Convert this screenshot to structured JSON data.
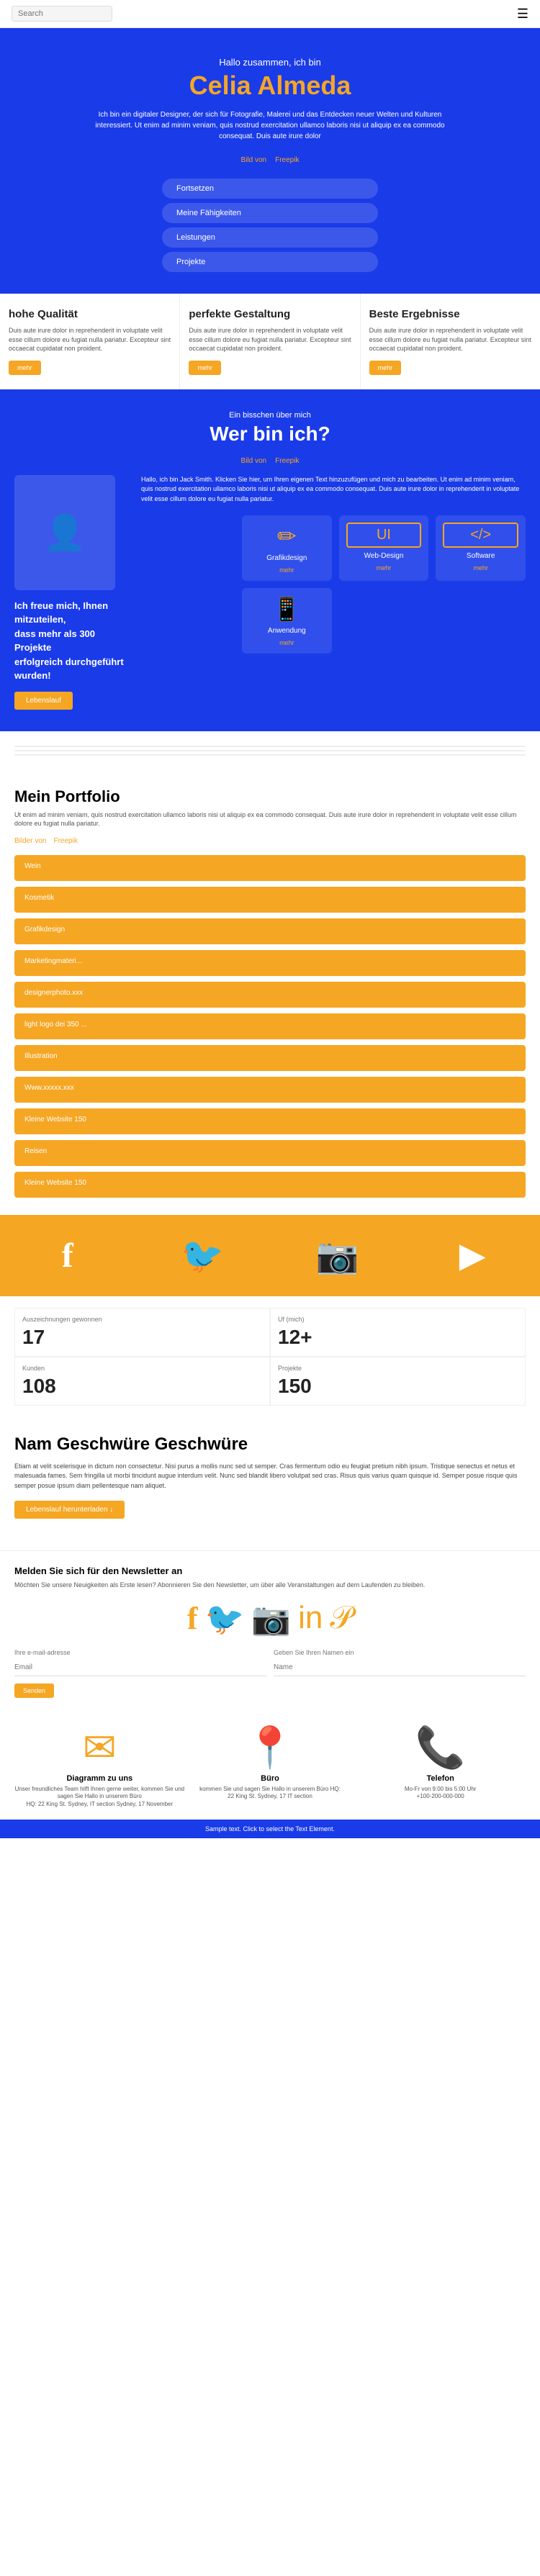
{
  "header": {
    "search_placeholder": "Search",
    "hamburger_icon": "☰"
  },
  "hero": {
    "greeting": "Hallo zusammen, ich bin",
    "name": "Celia Almeda",
    "description": "Ich bin ein digitaler Designer, der sich für Fotografie, Malerei und das Entdecken neuer Welten und Kulturen interessiert. Ut enim ad minim veniam, quis nostrud exercitation ullamco laboris nisi ut aliquip ex ea commodo consequat. Duis aute irure dolor",
    "toggle_bild": "Bild von",
    "toggle_freepik": "Freepik",
    "menu_items": [
      "Fortsetzen",
      "Meine Fähigkeiten",
      "Leistungen",
      "Projekte"
    ]
  },
  "features": [
    {
      "title": "hohe Qualität",
      "description": "Duis aute irure dolor in reprehenderit in voluptate velit esse cillum dolore eu fugiat nulla pariatur. Excepteur sint occaecat cupidatat non proident.",
      "button_label": "mehr"
    },
    {
      "title": "perfekte Gestaltung",
      "description": "Duis aute irure dolor in reprehenderit in voluptate velit esse cillum dolore eu fugiat nulla pariatur. Excepteur sint occaecat cupidatat non proident.",
      "button_label": "mehr"
    },
    {
      "title": "Beste Ergebnisse",
      "description": "Duis aute irure dolor in reprehenderit in voluptate velit esse cillum dolore eu fugiat nulla pariatur. Excepteur sint occaecat cupidatat non proident.",
      "button_label": "mehr"
    }
  ],
  "about": {
    "sub": "Ein bisschen über mich",
    "title": "Wer bin ich?",
    "toggle_bild": "Bild von",
    "toggle_freepik": "Freepik",
    "description": "Hallo, ich bin Jack Smith. Klicken Sie hier, um Ihren eigenen Text hinzuzufügen und mich zu bearbeiten. Ut enim ad minim veniam, quis nostrud exercitation ullamco laboris nisi ut aliquip ex ea commodo consequat. Duis aute irure dolor in reprehenderit in voluptate velit esse cillum dolore eu fugiat nulla pariatur.",
    "boast": "Ich freue mich, Ihnen mitzuteilen,\ndass mehr als 300 Projekte\nerfolgreich durchgeführt wurden!",
    "cta_label": "Lebenslauf",
    "services": [
      {
        "icon": "✏",
        "label": "Grafikdesign",
        "more": "mehr"
      },
      {
        "icon": "UI",
        "label": "Web-Design",
        "more": "mehr"
      },
      {
        "icon": "</>",
        "label": "Software",
        "more": "mehr"
      },
      {
        "icon": "📱",
        "label": "Anwendung",
        "more": "mehr"
      }
    ]
  },
  "portfolio": {
    "title": "Mein Portfolio",
    "description": "Ut enim ad minim veniam, quis nostrud exercitation ullamco laboris nisi ut aliquip ex ea commodo consequat. Duis aute irure dolor in reprehenderit in voluptate velit esse cillum dolore eu fugiat nulla pariatur.",
    "toggle_bild": "Bilder von",
    "toggle_freepik": "Freepik",
    "items": [
      {
        "label": "Wein"
      },
      {
        "label": "Kosmetik"
      },
      {
        "label": "Grafikdesign"
      },
      {
        "label": "Marketingmateri..."
      },
      {
        "label": "designerphoto.xxx"
      },
      {
        "label": "light logo dei 350 ..."
      },
      {
        "label": "Illustration"
      },
      {
        "label": "Www.xxxxx.xxx"
      },
      {
        "label": "Kleine Website 150"
      },
      {
        "label": "Reisen"
      },
      {
        "label": "Kleine Website 150"
      }
    ]
  },
  "social": {
    "icons": [
      "f",
      "🐦",
      "📷",
      "▶"
    ]
  },
  "stats": [
    {
      "label": "Auszeichnungen gewonnen",
      "value": "17"
    },
    {
      "label": "Uf (mich)",
      "value": "12+"
    },
    {
      "label": "Kunden",
      "value": "108"
    },
    {
      "label": "Projekte",
      "value": "150"
    }
  ],
  "blog": {
    "title": "Nam Geschwüre Geschwüre",
    "text": "Etiam at velit scelerisque in dictum non consectetur. Nisi purus a mollis nunc sed ut semper. Cras fermentum odio eu feugiat pretium nibh ipsum. Tristique senectus et netus et malesuada fames. Sem fringilla ut morbi tincidunt augue interdum velit. Nunc sed blandit libero volutpat sed cras. Risus quis varius quam quisque id. Semper posue risque quis semper posue ipsum diam pellentesque nam aliquet.",
    "cta_label": "Lebenslauf herunterladen ↓"
  },
  "newsletter": {
    "title": "Melden Sie sich für den Newsletter an",
    "description": "Möchten Sie unsere Neuigkeiten als Erste lesen? Abonnieren Sie den Newsletter, um über alle Veranstaltungen auf dem Laufenden zu bleiben.",
    "email_placeholder": "Email",
    "name_placeholder": "Name",
    "email_label": "Ihre e-mail-adresse",
    "name_label": "Geben Sie Ihren Namen ein",
    "submit_label": "Senden"
  },
  "footer_contacts": [
    {
      "icon": "✉",
      "title": "Diagramm zu uns",
      "text": "Unser freundliches Team hilft Ihnen gerne weiter, kommen Sie und sagen Sie Hallo in unserem Büro",
      "detail": "HQ: 22 King St. Sydney, IT section\nSydney, 17 November"
    },
    {
      "icon": "📍",
      "title": "Büro",
      "text": "kommen Sie und sagen Sie Hallo in unserem Büro HQ:",
      "detail": "22 King St. Sydney, 17 IT section"
    },
    {
      "icon": "📞",
      "title": "Telefon",
      "text": "Mo-Fr von 9:00 bis 5:00 Uhr",
      "detail": "+100-200-000-000"
    }
  ],
  "footer_bar": {
    "text": "Sample text. Click to select the Text Element."
  }
}
